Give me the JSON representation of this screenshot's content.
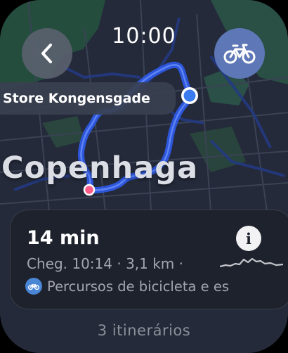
{
  "status": {
    "time": "10:00"
  },
  "map": {
    "poi_label": "Store Kongensgade",
    "city_label": "Copenhaga",
    "route_color": "#2f5ae8",
    "water_color": "#244d3e",
    "land_color": "#242a3a"
  },
  "buttons": {
    "back_icon": "chevron-left-icon",
    "mode_icon": "bicycle-icon"
  },
  "route_card": {
    "duration": "14 min",
    "info_icon": "i",
    "details": "Cheg. 10:14 · 3,1 km ·",
    "route_type": "Percursos de bicicleta e es"
  },
  "footer": {
    "more_routes": "3 itinerários"
  },
  "colors": {
    "accent": "#5e77b6",
    "origin_pin": "#3a7bf0",
    "destination_pin": "#ff5c8a"
  }
}
